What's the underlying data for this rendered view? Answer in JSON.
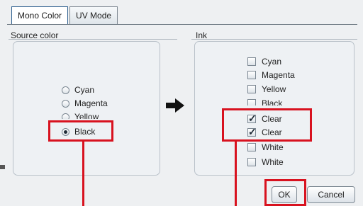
{
  "tabs": [
    {
      "label": "Mono Color",
      "active": true
    },
    {
      "label": "UV Mode",
      "active": false
    }
  ],
  "source_color": {
    "label": "Source color",
    "options": [
      {
        "label": "Cyan",
        "selected": false
      },
      {
        "label": "Magenta",
        "selected": false
      },
      {
        "label": "Yellow",
        "selected": false
      },
      {
        "label": "Black",
        "selected": true
      }
    ]
  },
  "ink": {
    "label": "Ink",
    "options": [
      {
        "label": "Cyan",
        "checked": false
      },
      {
        "label": "Magenta",
        "checked": false
      },
      {
        "label": "Yellow",
        "checked": false
      },
      {
        "label": "Black",
        "checked": false
      },
      {
        "label": "Clear",
        "checked": true
      },
      {
        "label": "Clear",
        "checked": true
      },
      {
        "label": "White",
        "checked": false
      },
      {
        "label": "White",
        "checked": false
      }
    ]
  },
  "buttons": {
    "ok": "OK",
    "cancel": "Cancel"
  },
  "colors": {
    "highlight": "#d8121f",
    "tab_active_border": "#2e5f8f"
  }
}
